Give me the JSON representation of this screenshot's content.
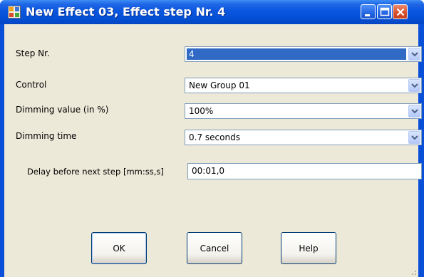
{
  "window": {
    "title": "New Effect 03, Effect step Nr. 4",
    "icons": [
      "app-icon",
      "minimize-icon",
      "maximize-icon",
      "close-icon"
    ]
  },
  "form": {
    "step_nr": {
      "label": "Step Nr.",
      "value": "4"
    },
    "control": {
      "label": "Control",
      "value": "New Group 01"
    },
    "dimming_value": {
      "label": "Dimming value (in %)",
      "value": "100%"
    },
    "dimming_time": {
      "label": "Dimming time",
      "value": "0.7 seconds"
    },
    "delay": {
      "label": "Delay before next step [mm:ss,s]",
      "value": "00:01,0"
    }
  },
  "buttons": {
    "ok": "OK",
    "cancel": "Cancel",
    "help": "Help"
  },
  "colors": {
    "title_bar": "#0a56de",
    "client_bg": "#ece9d8",
    "selection": "#316ac5",
    "close_button": "#d8512d"
  }
}
